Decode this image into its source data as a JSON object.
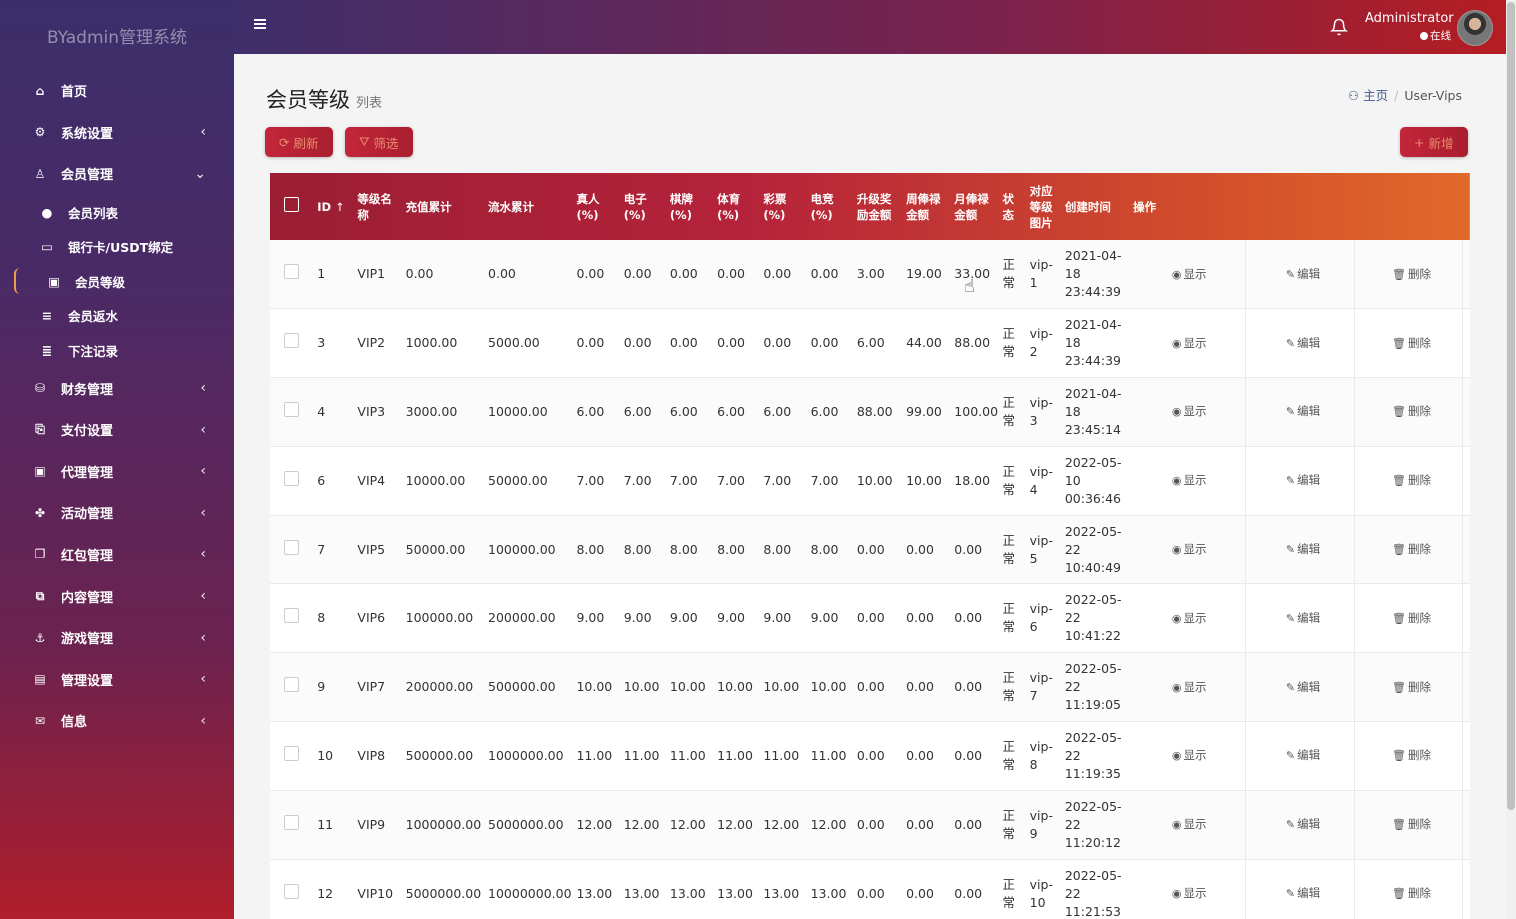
{
  "app": {
    "brand": "BYadmin管理系统"
  },
  "sidebar": {
    "items": [
      {
        "label": "首页",
        "icon": "home-icon"
      },
      {
        "label": "系统设置",
        "icon": "gears-icon",
        "chevron": "‹"
      },
      {
        "label": "会员管理",
        "icon": "user-icon",
        "chevron": "⌄"
      }
    ],
    "subitems": [
      {
        "label": "会员列表",
        "icon": "user-solid-icon"
      },
      {
        "label": "银行卡/USDT绑定",
        "icon": "credit-card-icon"
      },
      {
        "label": "会员等级",
        "icon": "id-card-icon"
      },
      {
        "label": "会员返水",
        "icon": "list-icon"
      },
      {
        "label": "下注记录",
        "icon": "list-align-icon"
      }
    ],
    "items2": [
      {
        "label": "财务管理",
        "icon": "database-icon",
        "chevron": "‹"
      },
      {
        "label": "支付设置",
        "icon": "bookmark-icon",
        "chevron": "‹"
      },
      {
        "label": "代理管理",
        "icon": "id-badge-icon",
        "chevron": "‹"
      },
      {
        "label": "活动管理",
        "icon": "fan-icon",
        "chevron": "‹"
      },
      {
        "label": "红包管理",
        "icon": "clone-icon",
        "chevron": "‹"
      },
      {
        "label": "内容管理",
        "icon": "copy-icon",
        "chevron": "‹"
      },
      {
        "label": "游戏管理",
        "icon": "anchor-icon",
        "chevron": "‹"
      },
      {
        "label": "管理设置",
        "icon": "address-card-icon",
        "chevron": "‹"
      },
      {
        "label": "信息",
        "icon": "comments-icon",
        "chevron": "‹"
      }
    ]
  },
  "header": {
    "user_name": "Administrator",
    "user_status": "在线"
  },
  "page": {
    "title": "会员等级",
    "subtitle": "列表"
  },
  "breadcrumb": {
    "home": "主页",
    "current": "User-Vips"
  },
  "toolbar": {
    "refresh": "刷新",
    "filter": "筛选",
    "add": "新增"
  },
  "table": {
    "headers": [
      "ID",
      "等级名称",
      "充值累计",
      "流水累计",
      "真人(%)",
      "电子(%)",
      "棋牌(%)",
      "体育(%)",
      "彩票(%)",
      "电竞(%)",
      "升级奖励金额",
      "周俸禄金额",
      "月俸禄金额",
      "状态",
      "对应等级图片",
      "创建时间",
      "操作"
    ],
    "actions": {
      "view": "显示",
      "edit": "编辑",
      "delete": "删除"
    },
    "rows": [
      [
        "1",
        "VIP1",
        "0.00",
        "0.00",
        "0.00",
        "0.00",
        "0.00",
        "0.00",
        "0.00",
        "0.00",
        "3.00",
        "19.00",
        "33.00",
        "正常",
        "vip-1",
        "2021-04-18 23:44:39"
      ],
      [
        "3",
        "VIP2",
        "1000.00",
        "5000.00",
        "0.00",
        "0.00",
        "0.00",
        "0.00",
        "0.00",
        "0.00",
        "6.00",
        "44.00",
        "88.00",
        "正常",
        "vip-2",
        "2021-04-18 23:44:39"
      ],
      [
        "4",
        "VIP3",
        "3000.00",
        "10000.00",
        "6.00",
        "6.00",
        "6.00",
        "6.00",
        "6.00",
        "6.00",
        "88.00",
        "99.00",
        "100.00",
        "正常",
        "vip-3",
        "2021-04-18 23:45:14"
      ],
      [
        "6",
        "VIP4",
        "10000.00",
        "50000.00",
        "7.00",
        "7.00",
        "7.00",
        "7.00",
        "7.00",
        "7.00",
        "10.00",
        "10.00",
        "18.00",
        "正常",
        "vip-4",
        "2022-05-10 00:36:46"
      ],
      [
        "7",
        "VIP5",
        "50000.00",
        "100000.00",
        "8.00",
        "8.00",
        "8.00",
        "8.00",
        "8.00",
        "8.00",
        "0.00",
        "0.00",
        "0.00",
        "正常",
        "vip-5",
        "2022-05-22 10:40:49"
      ],
      [
        "8",
        "VIP6",
        "100000.00",
        "200000.00",
        "9.00",
        "9.00",
        "9.00",
        "9.00",
        "9.00",
        "9.00",
        "0.00",
        "0.00",
        "0.00",
        "正常",
        "vip-6",
        "2022-05-22 10:41:22"
      ],
      [
        "9",
        "VIP7",
        "200000.00",
        "500000.00",
        "10.00",
        "10.00",
        "10.00",
        "10.00",
        "10.00",
        "10.00",
        "0.00",
        "0.00",
        "0.00",
        "正常",
        "vip-7",
        "2022-05-22 11:19:05"
      ],
      [
        "10",
        "VIP8",
        "500000.00",
        "1000000.00",
        "11.00",
        "11.00",
        "11.00",
        "11.00",
        "11.00",
        "11.00",
        "0.00",
        "0.00",
        "0.00",
        "正常",
        "vip-8",
        "2022-05-22 11:19:35"
      ],
      [
        "11",
        "VIP9",
        "1000000.00",
        "5000000.00",
        "12.00",
        "12.00",
        "12.00",
        "12.00",
        "12.00",
        "12.00",
        "0.00",
        "0.00",
        "0.00",
        "正常",
        "vip-9",
        "2022-05-22 11:20:12"
      ],
      [
        "12",
        "VIP10",
        "5000000.00",
        "10000000.00",
        "13.00",
        "13.00",
        "13.00",
        "13.00",
        "13.00",
        "13.00",
        "0.00",
        "0.00",
        "0.00",
        "正常",
        "vip-10",
        "2022-05-22 11:21:53"
      ]
    ]
  }
}
